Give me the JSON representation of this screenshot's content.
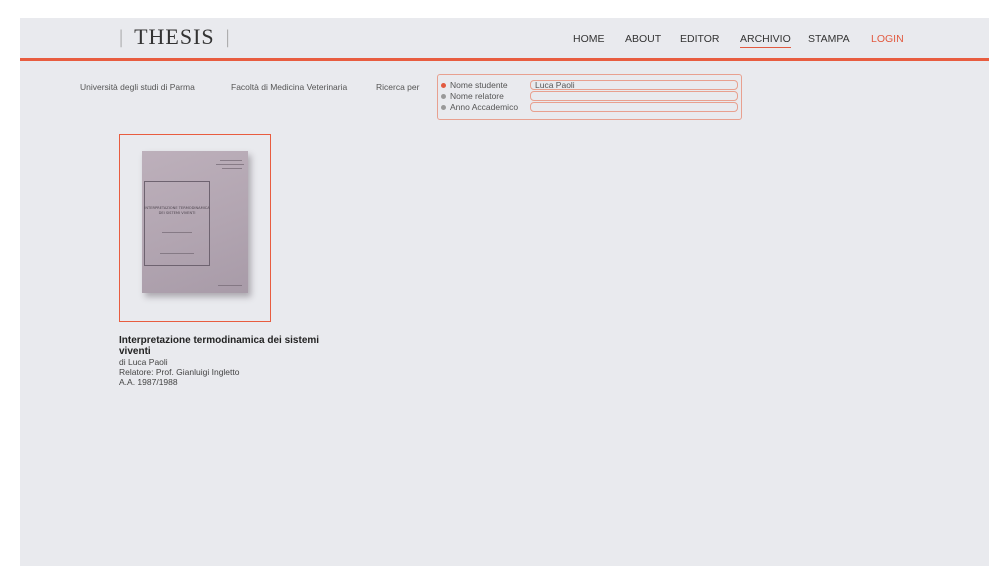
{
  "header": {
    "logo_text": "THESIS",
    "logo_divider": "|",
    "nav": [
      {
        "label": "HOME"
      },
      {
        "label": "ABOUT"
      },
      {
        "label": "EDITOR"
      },
      {
        "label": "ARCHIVIO",
        "active": true
      },
      {
        "label": "STAMPA"
      },
      {
        "label": "LOGIN"
      }
    ]
  },
  "filters": {
    "university": "Università degli studi di Parma",
    "faculty": "Facoltà di Medicina Veterinaria",
    "search_by_label": "Ricerca per",
    "fields": [
      {
        "label": "Nome studente",
        "value": "Luca Paoli",
        "selected": true
      },
      {
        "label": "Nome relatore",
        "value": "",
        "selected": false
      },
      {
        "label": "Anno Accademico",
        "value": "",
        "selected": false
      }
    ]
  },
  "results": [
    {
      "title": "Interpretazione termodinamica dei sistemi viventi",
      "author": "di Luca Paoli",
      "supervisor": "Relatore: Prof. Gianluigi Ingletto",
      "year": "A.A. 1987/1988",
      "cover": {
        "heading": "INTERPRETAZIONE TERMODINAMICA DEI SISTEMI VIVENTI"
      }
    }
  ],
  "colors": {
    "accent": "#e85c3f",
    "background": "#e9eaee",
    "cover": "#b5a8b4"
  }
}
